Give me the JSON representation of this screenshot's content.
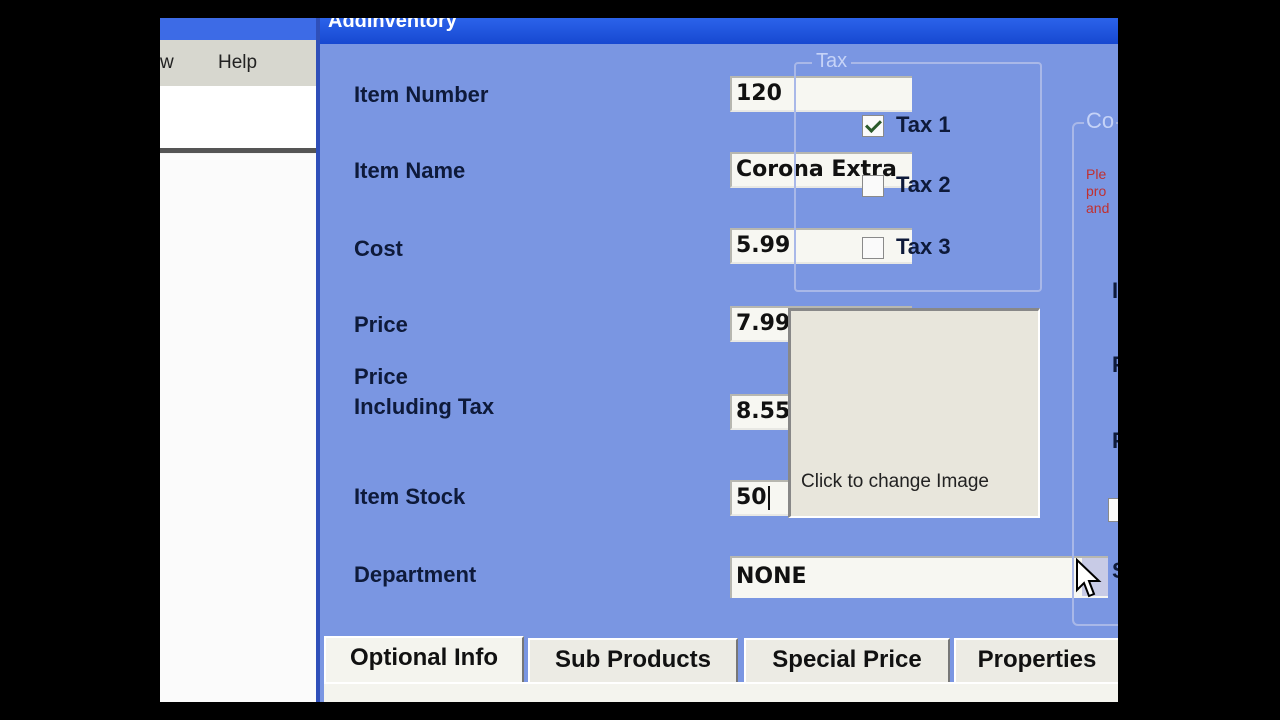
{
  "background_window": {
    "title": "",
    "menu": {
      "view": "w",
      "help": "Help"
    }
  },
  "dialog": {
    "title": "AddInventory",
    "fields": {
      "item_number": {
        "label": "Item Number",
        "value": "120"
      },
      "item_name": {
        "label": "Item Name",
        "value": "Corona Extra"
      },
      "cost": {
        "label": "Cost",
        "value": "5.99"
      },
      "price": {
        "label": "Price",
        "value": "7.99"
      },
      "price_incl_tax": {
        "label_line1": "Price",
        "label_line2": "Including Tax",
        "value": "8.55"
      },
      "item_stock": {
        "label": "Item Stock",
        "value": "50"
      },
      "department": {
        "label": "Department",
        "value": "NONE"
      }
    },
    "tax": {
      "title": "Tax",
      "items": [
        {
          "label": "Tax 1",
          "checked": true
        },
        {
          "label": "Tax 2",
          "checked": false
        },
        {
          "label": "Tax 3",
          "checked": false
        }
      ]
    },
    "image_panel": {
      "caption": "Click to change Image"
    },
    "right_group": {
      "title": "Co",
      "note_line1": "Ple",
      "note_line2": "pro",
      "note_line3": "and",
      "letters": [
        "I",
        "F",
        "F",
        "S"
      ]
    },
    "tabs": [
      {
        "label": "Optional Info",
        "active": true
      },
      {
        "label": "Sub Products",
        "active": false
      },
      {
        "label": "Special Price",
        "active": false
      },
      {
        "label": "Properties",
        "active": false
      }
    ]
  },
  "colors": {
    "dialog_bg": "#7a96e2",
    "titlebar": "#1748d1",
    "label_text": "#0e1a3a"
  }
}
